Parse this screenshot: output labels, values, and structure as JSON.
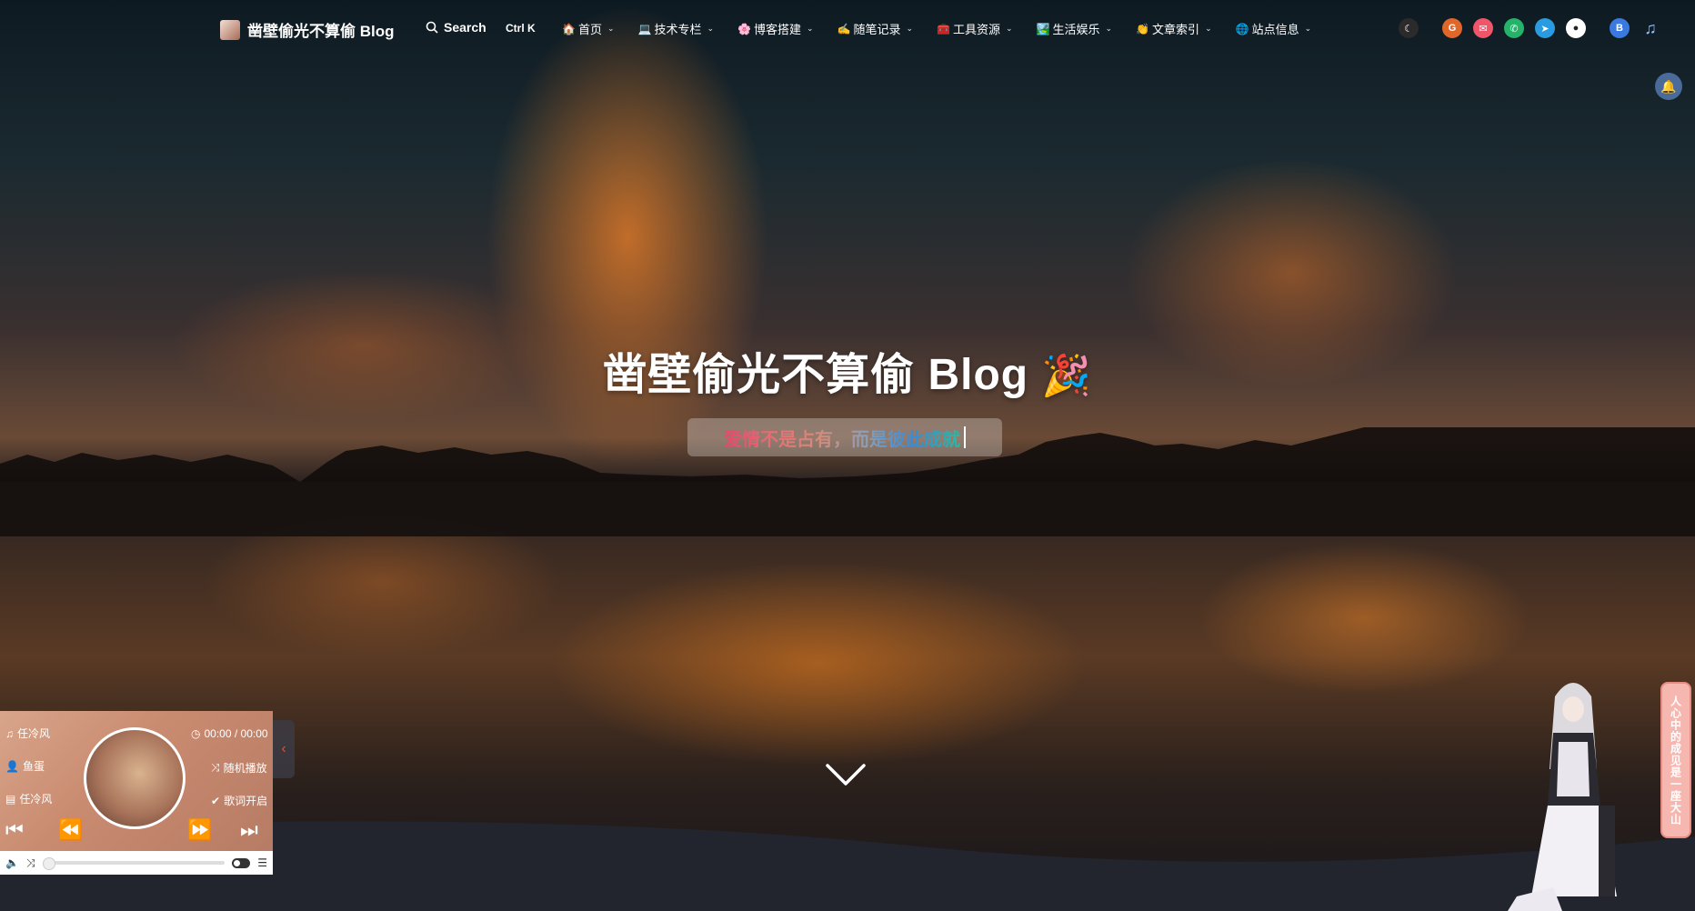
{
  "site": {
    "brand_title": "凿壁偷光不算偷 Blog",
    "search_label": "Search",
    "search_shortcut": "Ctrl K"
  },
  "nav": {
    "items": [
      {
        "emoji": "🏠",
        "label": "首页"
      },
      {
        "emoji": "💻",
        "label": "技术专栏"
      },
      {
        "emoji": "🌸",
        "label": "博客搭建"
      },
      {
        "emoji": "✍️",
        "label": "随笔记录"
      },
      {
        "emoji": "🧰",
        "label": "工具资源"
      },
      {
        "emoji": "🏞️",
        "label": "生活娱乐"
      },
      {
        "emoji": "👏",
        "label": "文章索引"
      },
      {
        "emoji": "🌐",
        "label": "站点信息"
      }
    ],
    "right_icons": [
      {
        "name": "theme-toggle-icon",
        "glyph": "☾",
        "color": "#2b2b2b"
      },
      {
        "name": "gitee-icon",
        "glyph": "G",
        "color": "#e0662a"
      },
      {
        "name": "email-icon",
        "glyph": "✉",
        "color": "#f0566a"
      },
      {
        "name": "whatsapp-icon",
        "glyph": "✆",
        "color": "#25b36a"
      },
      {
        "name": "telegram-icon",
        "glyph": "➤",
        "color": "#2a9be0"
      },
      {
        "name": "github-icon",
        "glyph": "●",
        "color": "#222222"
      },
      {
        "name": "bilibili-icon",
        "glyph": "B",
        "color": "#3a7ae0"
      },
      {
        "name": "music-note-icon",
        "glyph": "♫",
        "color": "transparent"
      }
    ]
  },
  "hero": {
    "title": "凿壁偷光不算偷 Blog",
    "title_emoji": "🎉",
    "subtitle": "爱情不是占有，而是彼此成就"
  },
  "player": {
    "song": "任冷风",
    "artist": "鱼蛋",
    "album": "任冷风",
    "time": "00:00 / 00:00",
    "mode": "随机播放",
    "lyrics": "歌词开启",
    "progress": 0
  },
  "side_quote": "人心中的成见是一座大山",
  "colors": {
    "accent_orange": "#e0662a",
    "player_bg": "#c98b70",
    "quote_bg": "#f6b7b0"
  }
}
